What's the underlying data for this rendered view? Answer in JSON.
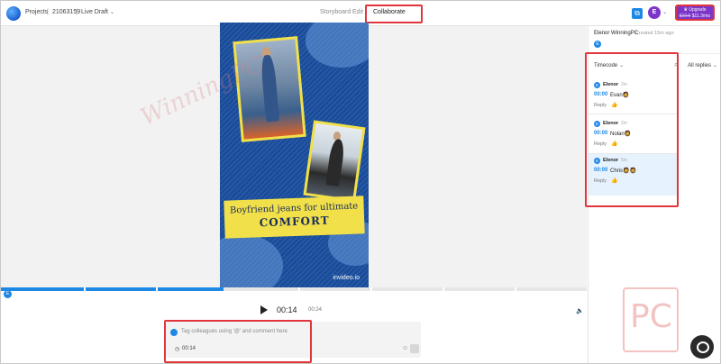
{
  "header": {
    "breadcrumb": [
      "Projects",
      "21063159",
      "Live Draft"
    ],
    "tabs": [
      "Storyboard",
      "Edit",
      "Collaborate"
    ],
    "active_tab": "Collaborate",
    "user_initial": "E",
    "upgrade": {
      "label": "Upgrade",
      "old_price": "$22.5",
      "new_price": "$11.3/mo"
    }
  },
  "video": {
    "headline_line1": "Boyfriend jeans for ultimate",
    "headline_line2": "COMFORT",
    "brand": "invideo.io"
  },
  "watermark": {
    "text": "WinningPC",
    "logo": "PC"
  },
  "playback": {
    "current_time": "00:14",
    "total_time": "00:24",
    "timeline_progress": 0.38
  },
  "comment_input": {
    "placeholder": "Tag colleagues using '@' and comment here",
    "timecode": "00:14"
  },
  "panel": {
    "project_owner": "Elenor WinningPC",
    "created": "Created 15m ago",
    "owner_initial": "E",
    "filter_label": "Timecode",
    "replies_filter": "All replies",
    "comments": [
      {
        "initial": "E",
        "author": "Elenor",
        "age": "2m",
        "timecode": "00:00",
        "text": "Evan🧔",
        "reply": "Reply"
      },
      {
        "initial": "E",
        "author": "Elenor",
        "age": "2m",
        "timecode": "00:00",
        "text": "Nolan🧔",
        "reply": "Reply"
      },
      {
        "initial": "E",
        "author": "Elenor",
        "age": "5m",
        "timecode": "00:00",
        "text": "Chris🧔🧔",
        "reply": "Reply"
      }
    ]
  },
  "colors": {
    "accent": "#1e88e5",
    "highlight": "#e0353b",
    "upgrade": "#7b35c8",
    "video_bg": "#1a4fa0",
    "banner": "#f1e04a"
  }
}
